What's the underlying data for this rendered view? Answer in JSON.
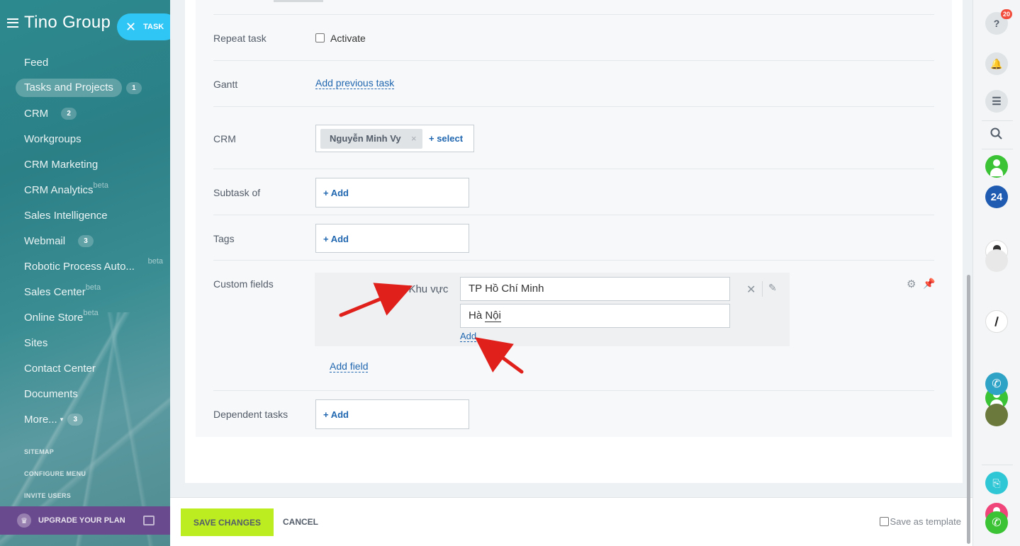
{
  "sidebar": {
    "logo": "Tino Group",
    "task_button": "TASK",
    "menu": [
      {
        "label": "Feed"
      },
      {
        "label": "Tasks and Projects",
        "count": "1",
        "active": true
      },
      {
        "label": "CRM",
        "count": "2"
      },
      {
        "label": "Workgroups"
      },
      {
        "label": "CRM Marketing"
      },
      {
        "label": "CRM Analytics",
        "beta": "beta"
      },
      {
        "label": "Sales Intelligence"
      },
      {
        "label": "Webmail",
        "count": "3"
      },
      {
        "label": "Robotic Process Auto...",
        "beta_right": "beta"
      },
      {
        "label": "Sales Center",
        "beta": "beta"
      },
      {
        "label": "Online Store",
        "beta": "beta"
      },
      {
        "label": "Sites"
      },
      {
        "label": "Contact Center"
      },
      {
        "label": "Documents"
      },
      {
        "label": "More...",
        "count": "3",
        "caret": true
      }
    ],
    "system_links": [
      "SITEMAP",
      "CONFIGURE MENU",
      "INVITE USERS"
    ],
    "upgrade": "UPGRADE YOUR PLAN"
  },
  "form": {
    "repeat_task": {
      "label": "Repeat task",
      "checkbox_label": "Activate"
    },
    "gantt": {
      "label": "Gantt",
      "link": "Add previous task"
    },
    "crm": {
      "label": "CRM",
      "entity": "Nguyễn Minh Vy",
      "remove": "×",
      "select": "+ select"
    },
    "subtask_of": {
      "label": "Subtask of",
      "add": "+ Add"
    },
    "tags": {
      "label": "Tags",
      "add": "+ Add"
    },
    "custom_fields": {
      "label": "Custom fields",
      "field_required_mark": "*",
      "field_name": "Khu vực",
      "values": [
        "TP Hồ Chí Minh",
        "Hà Nội"
      ],
      "value2_parts": [
        "Hà ",
        "Nội"
      ],
      "add_value": "Add",
      "add_field": "Add field"
    },
    "dependent_tasks": {
      "label": "Dependent tasks",
      "add": "+ Add"
    }
  },
  "footer": {
    "save": "SAVE CHANGES",
    "cancel": "CANCEL",
    "save_template": "Save as template"
  },
  "rightbar": {
    "help_badge": "20",
    "help_glyph": "?",
    "b24_label": "24"
  },
  "colors": {
    "accent_blue": "#2067b0",
    "save_green": "#bbed21",
    "task_cyan": "#2fc6f6",
    "annotation_red": "#e0201b"
  }
}
